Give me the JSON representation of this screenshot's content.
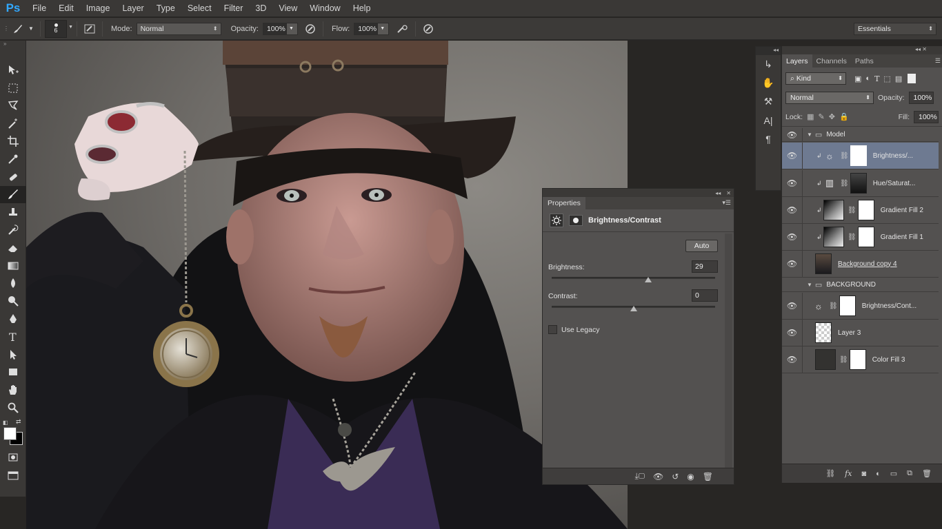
{
  "app": {
    "logo": "Ps"
  },
  "menu": [
    "File",
    "Edit",
    "Image",
    "Layer",
    "Type",
    "Select",
    "Filter",
    "3D",
    "View",
    "Window",
    "Help"
  ],
  "options": {
    "brush_size": "6",
    "mode_label": "Mode:",
    "mode_value": "Normal",
    "opacity_label": "Opacity:",
    "opacity_value": "100%",
    "flow_label": "Flow:",
    "flow_value": "100%",
    "workspace": "Essentials"
  },
  "tools": [
    "move-tool",
    "marquee-tool",
    "lasso-tool",
    "magic-wand-tool",
    "crop-tool",
    "eyedropper-tool",
    "healing-brush-tool",
    "brush-tool",
    "clone-stamp-tool",
    "history-brush-tool",
    "eraser-tool",
    "gradient-tool",
    "blur-tool",
    "dodge-tool",
    "pen-tool",
    "type-tool",
    "path-selection-tool",
    "rectangle-tool",
    "hand-tool",
    "zoom-tool"
  ],
  "properties": {
    "tab": "Properties",
    "title": "Brightness/Contrast",
    "auto_label": "Auto",
    "brightness_label": "Brightness:",
    "brightness_value": "29",
    "contrast_label": "Contrast:",
    "contrast_value": "0",
    "use_legacy_label": "Use Legacy",
    "brightness_level": 0.59,
    "contrast_level": 0.5
  },
  "layers_panel": {
    "tabs": [
      "Layers",
      "Channels",
      "Paths"
    ],
    "kind_label": "Kind",
    "blend_mode": "Normal",
    "opacity_label": "Opacity:",
    "opacity_value": "100%",
    "lock_label": "Lock:",
    "fill_label": "Fill:",
    "fill_value": "100%",
    "layers": [
      {
        "name": "Model",
        "type": "group"
      },
      {
        "name": "Brightness/...",
        "type": "adjustment",
        "selected": true
      },
      {
        "name": "Hue/Saturat...",
        "type": "adjustment"
      },
      {
        "name": "Gradient Fill 2",
        "type": "gradient"
      },
      {
        "name": "Gradient Fill 1",
        "type": "gradient"
      },
      {
        "name": "Background copy 4",
        "type": "pixel"
      },
      {
        "name": "BACKGROUND",
        "type": "group"
      },
      {
        "name": "Brightness/Cont...",
        "type": "adjustment"
      },
      {
        "name": "Layer 3",
        "type": "empty"
      },
      {
        "name": "Color Fill 3",
        "type": "fill"
      }
    ]
  }
}
